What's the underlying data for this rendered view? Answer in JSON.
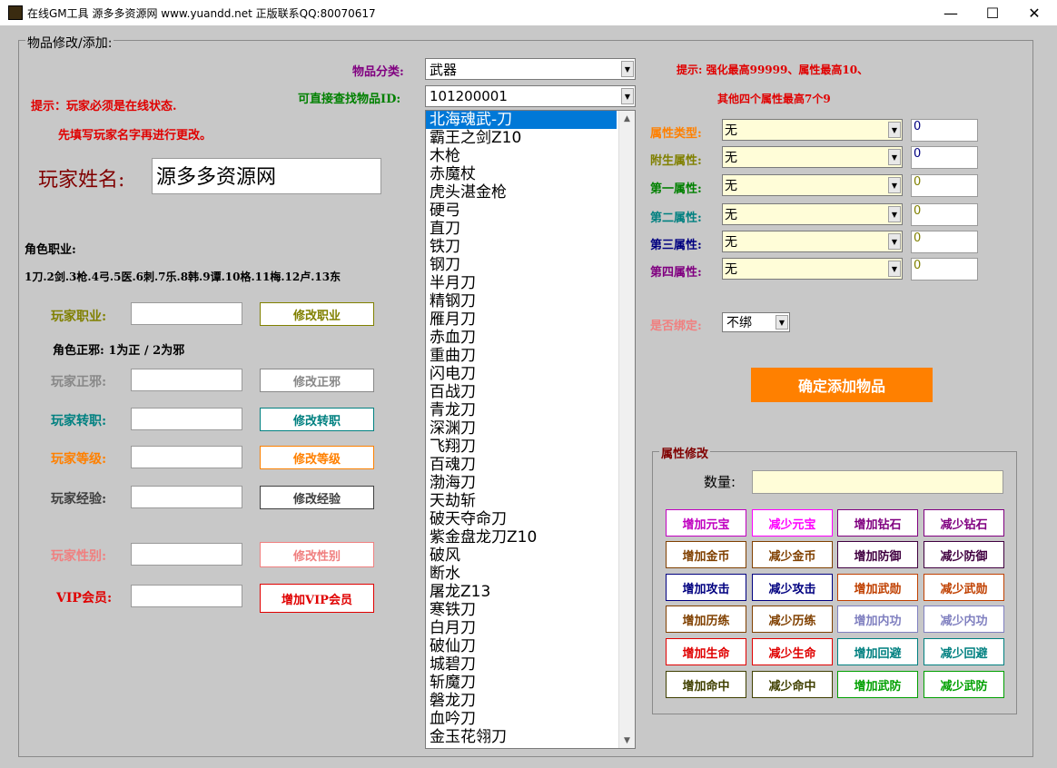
{
  "window": {
    "title": "在线GM工具 源多多资源网 www.yuandd.net 正版联系QQ:80070617",
    "min_glyph": "—",
    "max_glyph": "☐",
    "close_glyph": "✕"
  },
  "group_title": "物品修改/添加:",
  "tips": {
    "line1": "提示：玩家必须是在线状态.",
    "line2": "先填写玩家名字再进行更改。"
  },
  "player": {
    "name_label": "玩家姓名:",
    "name_value": "源多多资源网"
  },
  "job_info": {
    "title": "角色职业:",
    "list": "1刀.2剑.3枪.4弓.5医.6刺.7乐.8韩.9谭.10格.11梅.12卢.13东"
  },
  "align_info": "角色正邪: 1为正 / 2为邪",
  "rows": [
    {
      "label": "玩家职业:",
      "button": "修改职业",
      "color": "#808000",
      "value": ""
    },
    {
      "label": "玩家正邪:",
      "button": "修改正邪",
      "color": "#888888",
      "value": ""
    },
    {
      "label": "玩家转职:",
      "button": "修改转职",
      "color": "#008080",
      "value": ""
    },
    {
      "label": "玩家等级:",
      "button": "修改等级",
      "color": "#ff8000",
      "value": ""
    },
    {
      "label": "玩家经验:",
      "button": "修改经验",
      "color": "#404040",
      "value": ""
    },
    {
      "label": "玩家性别:",
      "button": "修改性别",
      "color": "#f08080",
      "value": ""
    },
    {
      "label": "VIP会员:",
      "button": "增加VIP会员",
      "color": "#e00000",
      "value": ""
    }
  ],
  "item": {
    "category_label": "物品分类:",
    "category_value": "武器",
    "search_label": "可直接查找物品ID:",
    "search_value": "101200001",
    "list": [
      "北海魂武-刀",
      "霸王之剑Z10",
      "木枪",
      "赤魔杖",
      "虎头湛金枪",
      "硬弓",
      "直刀",
      "铁刀",
      "钢刀",
      "半月刀",
      "精钢刀",
      "雁月刀",
      "赤血刀",
      "重曲刀",
      "闪电刀",
      "百战刀",
      "青龙刀",
      "深渊刀",
      "飞翔刀",
      "百魂刀",
      "渤海刀",
      "天劫斩",
      "破天夺命刀",
      "紫金盘龙刀Z10",
      "破风",
      "断水",
      "屠龙Z13",
      "寒铁刀",
      "白月刀",
      "破仙刀",
      "城碧刀",
      "斩魔刀",
      "磐龙刀",
      "血吟刀",
      "金玉花翎刀"
    ]
  },
  "right_tips": {
    "line1": "提示: 强化最高99999、属性最高10、",
    "line2": "其他四个属性最高7个9"
  },
  "attributes": [
    {
      "label": "属性类型:",
      "value": "无",
      "num": "0",
      "color": "#ff8000"
    },
    {
      "label": "附生属性:",
      "value": "无",
      "num": "0",
      "color": "#808000"
    },
    {
      "label": "第一属性:",
      "value": "无",
      "num": "0",
      "color": "#008000"
    },
    {
      "label": "第二属性:",
      "value": "无",
      "num": "0",
      "color": "#008080"
    },
    {
      "label": "第三属性:",
      "value": "无",
      "num": "0",
      "color": "#000080"
    },
    {
      "label": "第四属性:",
      "value": "无",
      "num": "0",
      "color": "#800080"
    }
  ],
  "bind": {
    "label": "是否绑定:",
    "value": "不绑"
  },
  "confirm_button": "确定添加物品",
  "attr_modify": {
    "title": "属性修改",
    "qty_label": "数量:",
    "qty_value": "",
    "buttons": [
      {
        "label": "增加元宝",
        "color": "#c000c0"
      },
      {
        "label": "减少元宝",
        "color": "#ff00ff"
      },
      {
        "label": "增加钻石",
        "color": "#800080"
      },
      {
        "label": "减少钻石",
        "color": "#800080"
      },
      {
        "label": "增加金币",
        "color": "#804000"
      },
      {
        "label": "减少金币",
        "color": "#804000"
      },
      {
        "label": "增加防御",
        "color": "#400040"
      },
      {
        "label": "减少防御",
        "color": "#400040"
      },
      {
        "label": "增加攻击",
        "color": "#000080"
      },
      {
        "label": "减少攻击",
        "color": "#000080"
      },
      {
        "label": "增加武勋",
        "color": "#c04000"
      },
      {
        "label": "减少武勋",
        "color": "#c04000"
      },
      {
        "label": "增加历练",
        "color": "#804000"
      },
      {
        "label": "减少历练",
        "color": "#804000"
      },
      {
        "label": "增加内功",
        "color": "#8080c0"
      },
      {
        "label": "减少内功",
        "color": "#8080c0"
      },
      {
        "label": "增加生命",
        "color": "#e00000"
      },
      {
        "label": "减少生命",
        "color": "#e00000"
      },
      {
        "label": "增加回避",
        "color": "#008080"
      },
      {
        "label": "减少回避",
        "color": "#008080"
      },
      {
        "label": "增加命中",
        "color": "#404000"
      },
      {
        "label": "减少命中",
        "color": "#404000"
      },
      {
        "label": "增加武防",
        "color": "#00a000"
      },
      {
        "label": "减少武防",
        "color": "#00a000"
      }
    ]
  }
}
